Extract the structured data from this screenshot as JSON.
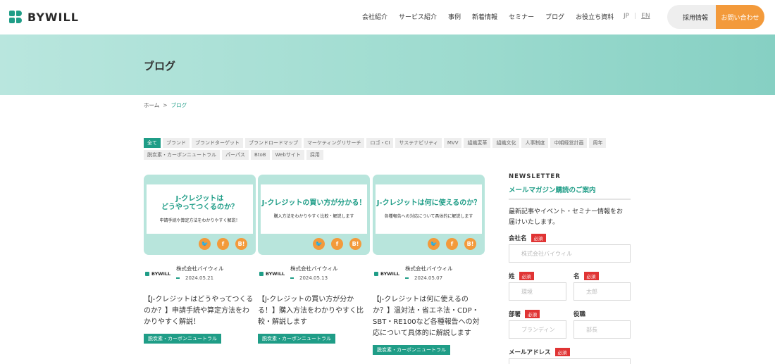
{
  "header": {
    "logo_text": "BYWILL",
    "nav": [
      "会社紹介",
      "サービス紹介",
      "事例",
      "新着情報",
      "セミナー",
      "ブログ",
      "お役立ち資料"
    ],
    "lang_jp": "JP",
    "lang_sep": "|",
    "lang_en": "EN",
    "recruit_label": "採用情報",
    "contact_label": "お問い合わせ"
  },
  "hero": {
    "title": "ブログ"
  },
  "breadcrumb": {
    "home": "ホーム",
    "sep": ">",
    "current": "ブログ"
  },
  "tags": {
    "row1": [
      "全て",
      "ブランド",
      "ブランドターゲット",
      "ブランドロードマップ",
      "マーケティングリサーチ",
      "ロゴ・CI",
      "サステナビリティ",
      "MVV",
      "組織変革",
      "組織文化",
      "人事制度",
      "中期経営計画",
      "周年"
    ],
    "row2": [
      "脱炭素・カーボンニュートラル",
      "パーパス",
      "BtoB",
      "Webサイト",
      "採用"
    ]
  },
  "cards": [
    {
      "thumb_title": "J-クレジットは\nどうやってつくるのか？",
      "thumb_sub": "申請手続や算定方法をわかりやすく解説！",
      "logo": "BYWILL",
      "author": "株式会社バイウィル",
      "date": "2024.05.21",
      "title": "【J-クレジットはどうやってつくるのか？】申請手続や算定方法をわかりやすく解説！",
      "tag": "脱炭素・カーボンニュートラル"
    },
    {
      "thumb_title": "J-クレジットの買い方が分かる！",
      "thumb_sub": "購入方法をわかりやすく比較・解説します",
      "logo": "BYWILL",
      "author": "株式会社バイウィル",
      "date": "2024.05.13",
      "title": "【J-クレジットの買い方が分かる！】購入方法をわかりやすく比較・解説します",
      "tag": "脱炭素・カーボンニュートラル"
    },
    {
      "thumb_title": "J-クレジットは何に使えるのか？",
      "thumb_sub": "各種報告への対応について具体的に解説します",
      "logo": "BYWILL",
      "author": "株式会社バイウィル",
      "date": "2024.05.07",
      "title": "【J-クレジットは何に使えるのか？】温対法・省エネ法・CDP・SBT・RE100など各種報告への対応について具体的に解説します",
      "tag": "脱炭素・カーボンニュートラル"
    }
  ],
  "share_icons": {
    "twitter": "🐦",
    "facebook": "f",
    "hatena": "B!"
  },
  "newsletter": {
    "en_title": "NEWSLETTER",
    "jp_title": "メールマガジン購読のご案内",
    "desc": "最新記事やイベント・セミナー情報をお届けいたします。",
    "required": "必須",
    "company_label": "会社名",
    "company_placeholder": "株式会社バイウィル",
    "last_label": "姓",
    "last_placeholder": "環境",
    "first_label": "名",
    "first_placeholder": "太郎",
    "dept_label": "部署",
    "dept_placeholder": "ブランディン",
    "role_label": "役職",
    "role_placeholder": "部長",
    "email_label": "メールアドレス"
  },
  "colors": {
    "accent": "#1f9d87",
    "orange": "#f39a3b",
    "required": "#e03434",
    "hero": "#9fdcd0"
  }
}
